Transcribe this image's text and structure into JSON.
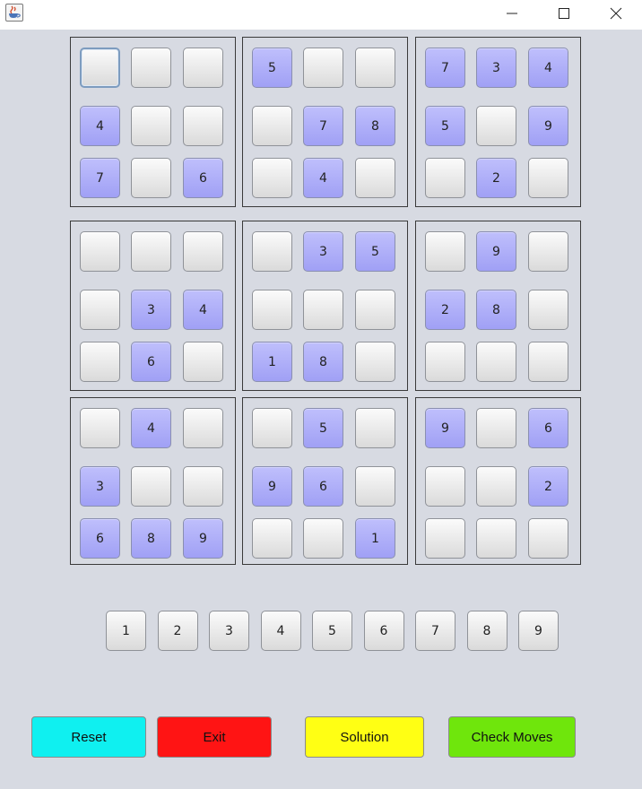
{
  "window": {
    "icons": {
      "app": "java-cup-icon",
      "minimize": "minimize-icon",
      "maximize": "maximize-icon",
      "close": "close-icon"
    }
  },
  "board": {
    "grid": [
      [
        "",
        "",
        "",
        "5",
        "",
        "",
        "7",
        "3",
        "4"
      ],
      [
        "4",
        "",
        "",
        "",
        "7",
        "8",
        "5",
        "",
        "9"
      ],
      [
        "7",
        "",
        "6",
        "",
        "4",
        "",
        "",
        "2",
        ""
      ],
      [
        "",
        "",
        "",
        "",
        "3",
        "5",
        "",
        "9",
        ""
      ],
      [
        "",
        "3",
        "4",
        "",
        "",
        "",
        "2",
        "8",
        ""
      ],
      [
        "",
        "6",
        "",
        "1",
        "8",
        "",
        "",
        "",
        ""
      ],
      [
        "",
        "4",
        "",
        "",
        "5",
        "",
        "9",
        "",
        "6"
      ],
      [
        "3",
        "",
        "",
        "9",
        "6",
        "",
        "",
        "",
        "2"
      ],
      [
        "6",
        "8",
        "9",
        "",
        "",
        "1",
        "",
        "",
        ""
      ]
    ],
    "selected_cell": [
      0,
      0
    ],
    "given_color": "#a8a8f8"
  },
  "number_pad": [
    "1",
    "2",
    "3",
    "4",
    "5",
    "6",
    "7",
    "8",
    "9"
  ],
  "actions": {
    "reset": {
      "label": "Reset",
      "color": "#0ff0f0"
    },
    "exit": {
      "label": "Exit",
      "color": "#ff1414"
    },
    "solution": {
      "label": "Solution",
      "color": "#ffff14"
    },
    "check": {
      "label": "Check Moves",
      "color": "#6fe60c"
    }
  }
}
